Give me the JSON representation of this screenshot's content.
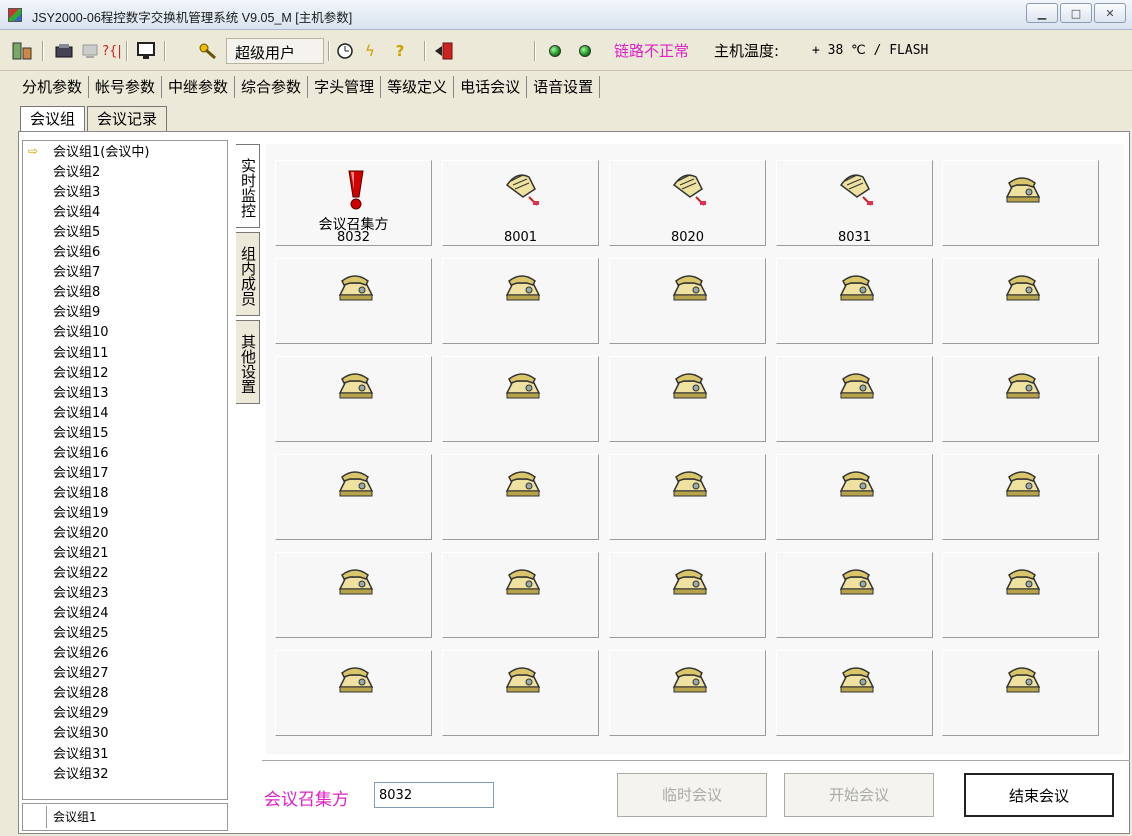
{
  "window": {
    "title": "JSY2000-06程控数字交换机管理系统 V9.05_M [主机参数]",
    "buttons": [
      "minimize",
      "maximize",
      "close"
    ]
  },
  "toolbar": {
    "user_label": "超级用户",
    "link_status": "链路不正常",
    "temp_label": "主机温度:",
    "temp_value": "+ 38 ℃ / FLASH",
    "icons": [
      "switch-icon",
      "telephone-icon",
      "computer-icon",
      "help-bracket-icon",
      "monitor-icon",
      "key-icon",
      "clock-icon",
      "lightning-icon",
      "question-icon",
      "exit-icon",
      "led-green-icon",
      "led-green-icon"
    ]
  },
  "main_tabs": [
    "分机参数",
    "帐号参数",
    "中继参数",
    "综合参数",
    "字头管理",
    "等级定义",
    "电话会议",
    "语音设置"
  ],
  "main_tab_active": "电话会议",
  "sub_tabs": [
    "会议组",
    "会议记录"
  ],
  "sub_tab_active": "会议组",
  "groups": [
    "会议组1(会议中)",
    "会议组2",
    "会议组3",
    "会议组4",
    "会议组5",
    "会议组6",
    "会议组7",
    "会议组8",
    "会议组9",
    "会议组10",
    "会议组11",
    "会议组12",
    "会议组13",
    "会议组14",
    "会议组15",
    "会议组16",
    "会议组17",
    "会议组18",
    "会议组19",
    "会议组20",
    "会议组21",
    "会议组22",
    "会议组23",
    "会议组24",
    "会议组25",
    "会议组26",
    "会议组27",
    "会议组28",
    "会议组29",
    "会议组30",
    "会议组31",
    "会议组32"
  ],
  "selected_group": "会议组1",
  "vertical_tabs": [
    "实时监控",
    "组内成员",
    "其他设置"
  ],
  "tiles": [
    {
      "role": "会议召集方",
      "number": "8032",
      "icon": "alert-icon"
    },
    {
      "role": "",
      "number": "8001",
      "icon": "phone-ringing-icon"
    },
    {
      "role": "",
      "number": "8020",
      "icon": "phone-ringing-icon"
    },
    {
      "role": "",
      "number": "8031",
      "icon": "phone-ringing-icon"
    }
  ],
  "bottom": {
    "caller_label": "会议召集方",
    "caller_value": "8032",
    "btn_temp": "临时会议",
    "btn_start": "开始会议",
    "btn_end": "结束会议"
  },
  "colors": {
    "accent_magenta": "#e020c8",
    "background": "#ece9d8"
  }
}
